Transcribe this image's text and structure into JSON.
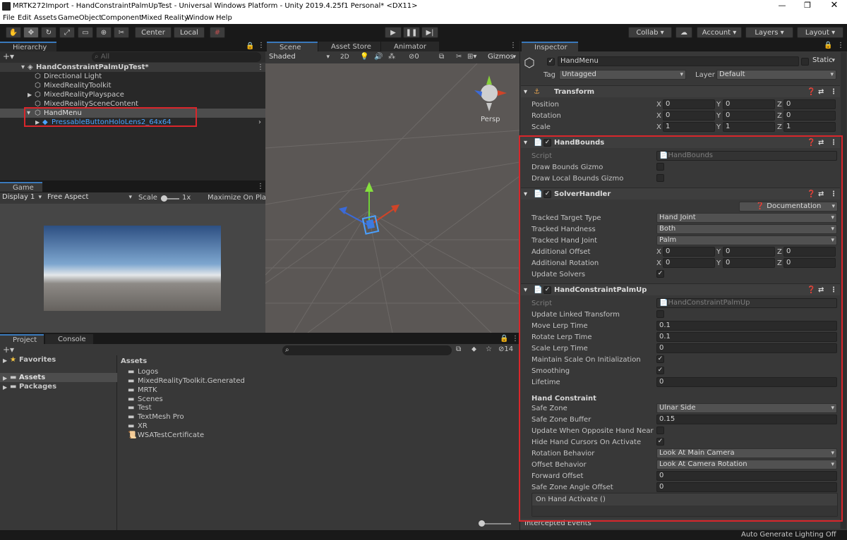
{
  "window": {
    "title": "MRTK272Import - HandConstraintPalmUpTest - Universal Windows Platform - Unity 2019.4.25f1 Personal* <DX11>"
  },
  "menu": [
    "File",
    "Edit",
    "Assets",
    "GameObject",
    "Component",
    "Mixed Reality",
    "Window",
    "Help"
  ],
  "toolbar": {
    "center": "Center",
    "local": "Local",
    "collab": "Collab",
    "account": "Account",
    "layers": "Layers",
    "layout": "Layout"
  },
  "hierarchy": {
    "tab": "Hierarchy",
    "search_placeholder": "All",
    "scene": "HandConstraintPalmUpTest*",
    "items": [
      "Directional Light",
      "MixedRealityToolkit",
      "MixedRealityPlayspace",
      "MixedRealitySceneContent",
      "HandMenu",
      "PressableButtonHoloLens2_64x64"
    ]
  },
  "scene_view": {
    "tabs": [
      "Scene",
      "Asset Store",
      "Animator"
    ],
    "shading": "Shaded",
    "mode_2d": "2D",
    "hidden_count": "0",
    "gizmos": "Gizmos",
    "persp": "Persp"
  },
  "game_view": {
    "tab": "Game",
    "display": "Display 1",
    "aspect": "Free Aspect",
    "scale_label": "Scale",
    "scale_value": "1x",
    "maximize": "Maximize On Play"
  },
  "project": {
    "tabs": [
      "Project",
      "Console"
    ],
    "favorites": "Favorites",
    "tree": [
      "Assets",
      "Packages"
    ],
    "breadcrumb": "Assets",
    "hidden_count": "14",
    "folders": [
      "Logos",
      "MixedRealityToolkit.Generated",
      "MRTK",
      "Scenes",
      "Test",
      "TextMesh Pro",
      "XR"
    ],
    "files": [
      "WSATestCertificate"
    ]
  },
  "inspector": {
    "tab": "Inspector",
    "object_name": "HandMenu",
    "static_label": "Static",
    "tag_label": "Tag",
    "tag_value": "Untagged",
    "layer_label": "Layer",
    "layer_value": "Default",
    "transform": {
      "title": "Transform",
      "position_label": "Position",
      "position": {
        "x": "0",
        "y": "0",
        "z": "0"
      },
      "rotation_label": "Rotation",
      "rotation": {
        "x": "0",
        "y": "0",
        "z": "0"
      },
      "scale_label": "Scale",
      "scale": {
        "x": "1",
        "y": "1",
        "z": "1"
      }
    },
    "axes": {
      "x": "X",
      "y": "Y",
      "z": "Z"
    },
    "hand_bounds": {
      "title": "HandBounds",
      "script_label": "Script",
      "script_value": "HandBounds",
      "draw_bounds_gizmo": "Draw Bounds Gizmo",
      "draw_local_bounds_gizmo": "Draw Local Bounds Gizmo"
    },
    "solver_handler": {
      "title": "SolverHandler",
      "documentation": "Documentation",
      "tracked_target_type_label": "Tracked Target Type",
      "tracked_target_type": "Hand Joint",
      "tracked_handness_label": "Tracked Handness",
      "tracked_handness": "Both",
      "tracked_hand_joint_label": "Tracked Hand Joint",
      "tracked_hand_joint": "Palm",
      "additional_offset_label": "Additional Offset",
      "additional_offset": {
        "x": "0",
        "y": "0",
        "z": "0"
      },
      "additional_rotation_label": "Additional Rotation",
      "additional_rotation": {
        "x": "0",
        "y": "0",
        "z": "0"
      },
      "update_solvers_label": "Update Solvers"
    },
    "hand_constraint": {
      "title": "HandConstraintPalmUp",
      "script_label": "Script",
      "script_value": "HandConstraintPalmUp",
      "update_linked_transform": "Update Linked Transform",
      "move_lerp_time_label": "Move Lerp Time",
      "move_lerp_time": "0.1",
      "rotate_lerp_time_label": "Rotate Lerp Time",
      "rotate_lerp_time": "0.1",
      "scale_lerp_time_label": "Scale Lerp Time",
      "scale_lerp_time": "0",
      "maintain_scale_label": "Maintain Scale On Initialization",
      "smoothing_label": "Smoothing",
      "lifetime_label": "Lifetime",
      "lifetime": "0",
      "section": "Hand Constraint",
      "safe_zone_label": "Safe Zone",
      "safe_zone": "Ulnar Side",
      "safe_zone_buffer_label": "Safe Zone Buffer",
      "safe_zone_buffer": "0.15",
      "update_opposite_label": "Update When Opposite Hand Near",
      "hide_cursors_label": "Hide Hand Cursors On Activate",
      "rotation_behavior_label": "Rotation Behavior",
      "rotation_behavior": "Look At Main Camera",
      "offset_behavior_label": "Offset Behavior",
      "offset_behavior": "Look At Camera Rotation",
      "forward_offset_label": "Forward Offset",
      "forward_offset": "0",
      "angle_offset_label": "Safe Zone Angle Offset",
      "angle_offset": "0",
      "on_hand_activate": "On Hand Activate ()"
    },
    "intercepted_events": "Intercepted Events"
  },
  "status": "Auto Generate Lighting Off",
  "colors": {
    "highlight": "#d9262b",
    "selection": "#2c5d87",
    "link_blue": "#4ca3ff"
  }
}
